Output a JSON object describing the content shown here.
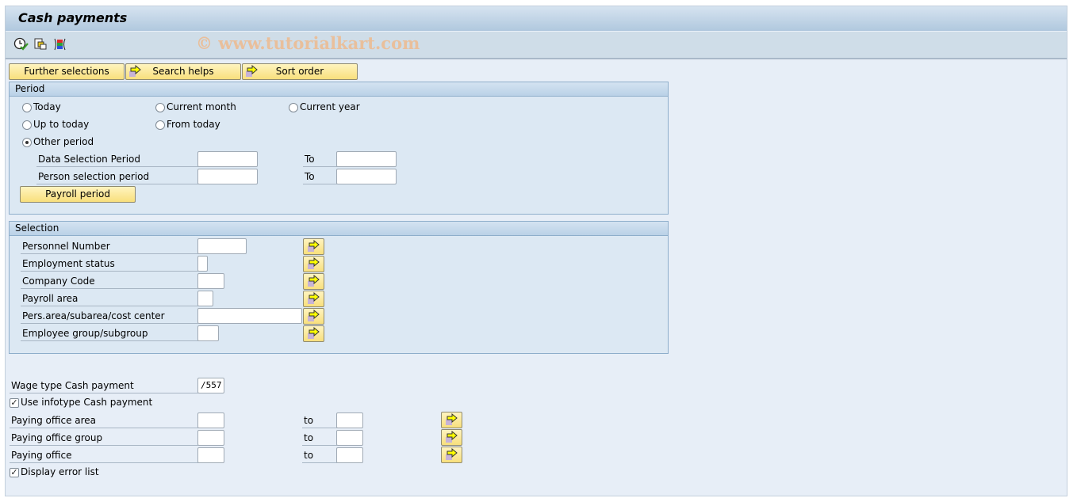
{
  "window": {
    "title": "Cash payments",
    "watermark": "© www.tutorialkart.com",
    "toolbar_icons": [
      "execute-clock-icon",
      "get-variant-icon",
      "selection-options-icon"
    ]
  },
  "tabs": {
    "further_selections": "Further selections",
    "search_helps": "Search helps",
    "sort_order": "Sort order"
  },
  "period": {
    "heading": "Period",
    "options": [
      {
        "label": "Today",
        "selected": false
      },
      {
        "label": "Current month",
        "selected": false
      },
      {
        "label": "Current year",
        "selected": false
      },
      {
        "label": "Up to today",
        "selected": false
      },
      {
        "label": "From today",
        "selected": false
      },
      {
        "label": "Other period",
        "selected": true
      }
    ],
    "data_selection_label": "Data Selection Period",
    "data_selection_from": "",
    "data_selection_to_label": "To",
    "data_selection_to": "",
    "person_selection_label": "Person selection period",
    "person_selection_from": "",
    "person_selection_to_label": "To",
    "person_selection_to": "",
    "payroll_period_button": "Payroll period"
  },
  "selection": {
    "heading": "Selection",
    "fields": [
      {
        "label": "Personnel Number",
        "value": ""
      },
      {
        "label": "Employment status",
        "value": ""
      },
      {
        "label": "Company Code",
        "value": ""
      },
      {
        "label": "Payroll area",
        "value": ""
      },
      {
        "label": "Pers.area/subarea/cost center",
        "value": ""
      },
      {
        "label": "Employee group/subgroup",
        "value": ""
      }
    ]
  },
  "parameters": {
    "wage_type_label": "Wage type Cash payment",
    "wage_type_value": "/557",
    "use_infotype_label": "Use infotype Cash payment",
    "use_infotype_checked": true,
    "ranges": [
      {
        "label": "Paying office area",
        "from": "",
        "to_label": "to",
        "to": ""
      },
      {
        "label": "Paying office group",
        "from": "",
        "to_label": "to",
        "to": ""
      },
      {
        "label": "Paying office",
        "from": "",
        "to_label": "to",
        "to": ""
      }
    ],
    "display_error_label": "Display error list",
    "display_error_checked": true
  }
}
